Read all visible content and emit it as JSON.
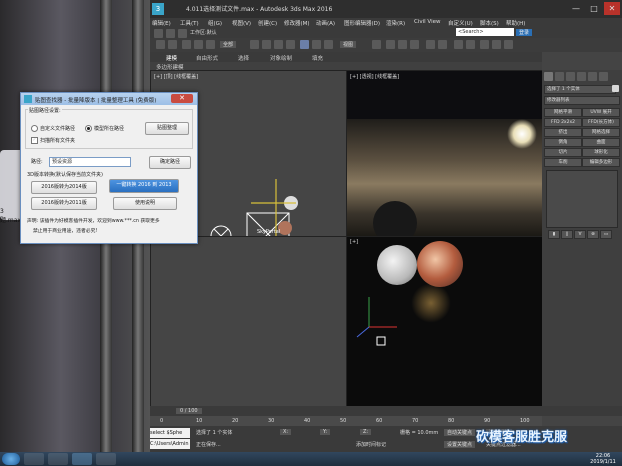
{
  "app": {
    "title": "4.011选择测试文件.max - Autodesk 3ds Max 2016",
    "window_buttons": [
      "—",
      "□",
      "✕"
    ]
  },
  "desktop": {
    "partial_text": "3题.max"
  },
  "menubar": [
    "编辑(E)",
    "工具(T)",
    "组(G)",
    "视图(V)",
    "创建(C)",
    "修改器(M)",
    "动画(A)",
    "图形编辑器(D)",
    "渲染(R)",
    "Civil View",
    "自定义(U)",
    "脚本(S)",
    "帮助(H)"
  ],
  "toolbar": {
    "workspace_label": "工作区:默认",
    "search_placeholder": "<Search>",
    "login_label": "登录",
    "view_dropdown": "视图",
    "selection_set": "全部"
  },
  "ribbon": {
    "tabs": [
      "建模",
      "自由形式",
      "选择",
      "对象绘制",
      "填充"
    ],
    "sub": "多边形建模"
  },
  "viewports": {
    "top_left_label": "[+] [顶] [线框覆盖]",
    "top_right_label": "[+] [透视] [线框覆盖]",
    "bottom_left_label": "[+]",
    "bottom_right_label": "[+]",
    "skylight_label": "SkyPortal"
  },
  "command_panel": {
    "field": "选择了 1 个实体",
    "modifier_list": "修改器列表",
    "buttons": [
      "网格平滑",
      "UVW 展开",
      "FFD 2x2x2",
      "FFD(长方体)",
      "挤出",
      "网格选择",
      "倒角",
      "曲面",
      "切片",
      "球形化",
      "车削",
      "编辑多边形"
    ],
    "stack_items": [
      "▮",
      "||",
      "∀",
      "⊗",
      "▭"
    ]
  },
  "timeline": {
    "frame": "0 / 100",
    "ticks": [
      "0",
      "10",
      "20",
      "30",
      "40",
      "50",
      "60",
      "70",
      "80",
      "90",
      "100"
    ]
  },
  "status": {
    "maxscript": "select $Sphe",
    "path": "C:\\Users\\Admin",
    "message": "选择了 1 个实体",
    "message2": "正在保存...",
    "grid": "栅格 = 10.0mm",
    "add_tag": "添加时间标记",
    "autokey": "自动关键点",
    "set_key": "设置关键点",
    "selected_obj": "选定对象",
    "key_filter": "关键点过滤器..."
  },
  "dialog": {
    "title": "贴图查找器 - 批量降版本 | 批量整理工具 (免费版)",
    "group_label": "贴图路径设置:",
    "radio1": "自定义文件路径",
    "radio2": "模型所在路径",
    "check_label": "扫描所有文件夹",
    "path_button": "贴图整理",
    "path_field_label": "路径:",
    "path_value": "预设资源",
    "confirm_path": "确定路径",
    "convert_label": "3D版本转换(默认保存当前文件夹)",
    "btn_2016_2014": "2016版转为2014版",
    "btn_highlight": "一键转换 2016 到 2013",
    "btn_2016_2011": "2016版转为2011版",
    "btn_use": "使用说明",
    "footer1": "声明: 该插件为好模客插件开发，欢迎到www.***.cn 获取更多",
    "footer2": "禁止用于商业用途，违者必究!"
  },
  "taskbar": {
    "time": "22:06",
    "date": "2019/1/11"
  },
  "watermark": "砍模客服胜克服"
}
